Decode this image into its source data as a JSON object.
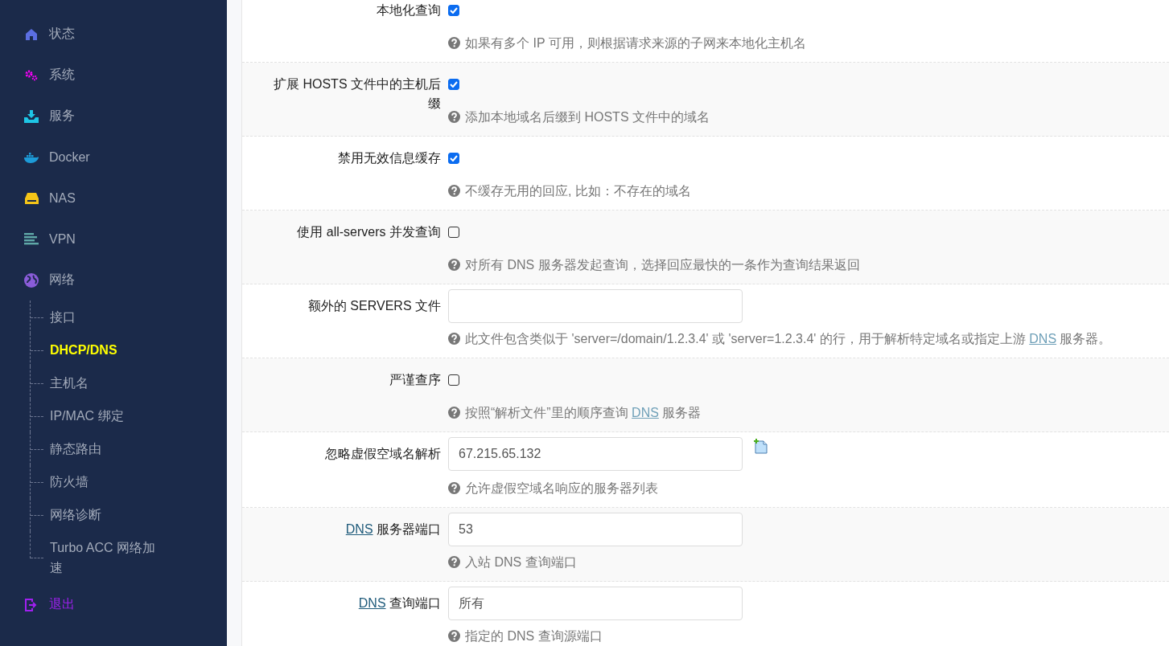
{
  "sidebar": {
    "items": [
      {
        "label": "状态",
        "selected": false
      },
      {
        "label": "系统",
        "selected": false
      },
      {
        "label": "服务",
        "selected": false
      },
      {
        "label": "Docker",
        "selected": false
      },
      {
        "label": "NAS",
        "selected": false
      },
      {
        "label": "VPN",
        "selected": false
      },
      {
        "label": "网络",
        "selected": false,
        "children": [
          {
            "label": "接口",
            "selected": false
          },
          {
            "label": "DHCP/DNS",
            "selected": true
          },
          {
            "label": "主机名",
            "selected": false
          },
          {
            "label": "IP/MAC 绑定",
            "selected": false
          },
          {
            "label": "静态路由",
            "selected": false
          },
          {
            "label": "防火墙",
            "selected": false
          },
          {
            "label": "网络诊断",
            "selected": false
          },
          {
            "label": "Turbo ACC 网络加速",
            "selected": false
          }
        ]
      }
    ],
    "logout": {
      "label": "退出"
    }
  },
  "form": {
    "rows": [
      {
        "kind": "checkbox",
        "label": [
          {
            "text": "本地化查询"
          }
        ],
        "checked": true,
        "help": [
          {
            "text": "如果有多个 IP 可用，则根据请求来源的子网来本地化主机名"
          }
        ]
      },
      {
        "kind": "checkbox",
        "label": [
          {
            "text": "扩展 HOSTS 文件中的主机后缀"
          }
        ],
        "checked": true,
        "help": [
          {
            "text": "添加本地域名后缀到 HOSTS 文件中的域名"
          }
        ]
      },
      {
        "kind": "checkbox",
        "label": [
          {
            "text": "禁用无效信息缓存"
          }
        ],
        "checked": true,
        "help": [
          {
            "text": "不缓存无用的回应, 比如：不存在的域名"
          }
        ]
      },
      {
        "kind": "checkbox",
        "label": [
          {
            "text": "使用 all-servers 并发查询"
          }
        ],
        "checked": false,
        "help": [
          {
            "text": "对所有 DNS 服务器发起查询，选择回应最快的一条作为查询结果返回"
          }
        ]
      },
      {
        "kind": "text",
        "label": [
          {
            "text": "额外的 SERVERS 文件"
          }
        ],
        "help": [
          {
            "text": "此文件包含类似于 'server=/domain/1.2.3.4' 或 'server=1.2.3.4' 的行，用于解析特定域名或指定上游 "
          },
          {
            "link": "DNS"
          },
          {
            "text": " 服务器。"
          }
        ]
      },
      {
        "kind": "checkbox",
        "label": [
          {
            "text": "严谨查序"
          }
        ],
        "checked": false,
        "help": [
          {
            "text": "按照“解析文件”里的顺序查询 "
          },
          {
            "link": "DNS"
          },
          {
            "text": " 服务器"
          }
        ]
      },
      {
        "kind": "list",
        "label": [
          {
            "text": "忽略虚假空域名解析"
          }
        ],
        "value": "67.215.65.132",
        "help": [
          {
            "text": "允许虚假空域名响应的服务器列表"
          }
        ]
      },
      {
        "kind": "text",
        "label": [
          {
            "link": "DNS"
          },
          {
            "text": " 服务器端口"
          }
        ],
        "value": "53",
        "help": [
          {
            "text": "入站 DNS 查询端口"
          }
        ]
      },
      {
        "kind": "text",
        "label": [
          {
            "link": "DNS"
          },
          {
            "text": " 查询端口"
          }
        ],
        "value": "所有",
        "help": [
          {
            "text": "指定的 DNS 查询源端口"
          }
        ]
      }
    ]
  }
}
